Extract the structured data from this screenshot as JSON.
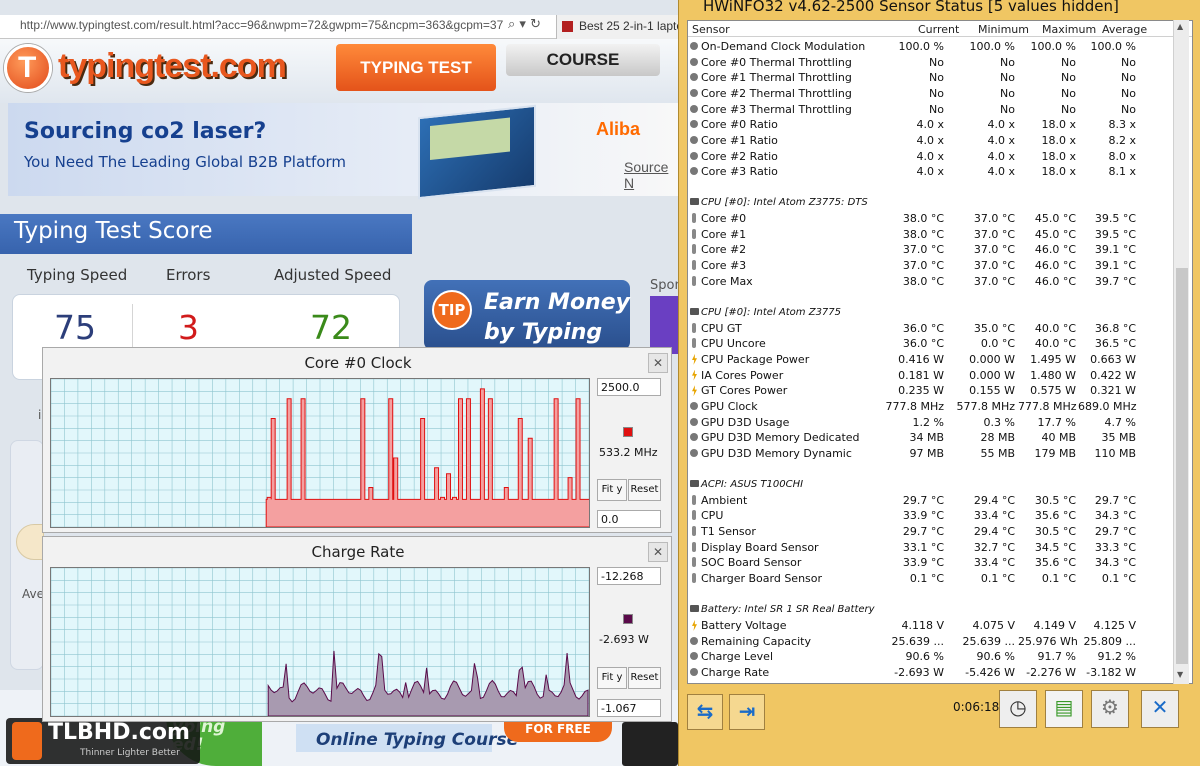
{
  "browser": {
    "url": "http://www.typingtest.com/result.html?acc=96&nwpm=72&gwpm=75&ncpm=363&gcpm=37",
    "tab2_title": "Best 25 2-in-1 lapto"
  },
  "site": {
    "logo": "typingtest.com",
    "nav_typing_test": "TYPING TEST",
    "nav_course": "COURSE",
    "ad_headline": "Sourcing co2 laser?",
    "ad_subline": "You Need The Leading Global B2B Platform",
    "ad_brand": "Aliba",
    "ad_link": "Source N",
    "score_title": "Typing Test Score",
    "labels": {
      "speed": "Typing Speed",
      "errors": "Errors",
      "adjusted": "Adjusted Speed"
    },
    "values": {
      "speed": "75",
      "errors": "3",
      "adjusted": "72"
    },
    "tip_badge": "TIP",
    "tip_text_1": "Earn Money",
    "tip_text_2": "by Typing",
    "sponsor": "Spon",
    "left_fragment": "i",
    "ave_fragment": "Ave",
    "bottom_green": "yping\ned!",
    "bottom_course": "Online Typing Course",
    "bottom_free": "FOR FREE",
    "watermark": "TLBHD.com",
    "watermark_sub": "Thinner Lighter Better"
  },
  "graph_clock": {
    "title": "Core #0 Clock",
    "max_value": "2500.0",
    "current_value": "533.2 MHz",
    "min_value": "0.0",
    "color": "#f08a8a",
    "swatch_color": "#e01010",
    "fit_y": "Fit y",
    "reset": "Reset"
  },
  "graph_charge": {
    "title": "Charge Rate",
    "max_value": "-12.268",
    "current_value": "-2.693 W",
    "min_value": "-1.067",
    "color": "#9a8aa8",
    "swatch_color": "#5a0a4a",
    "fit_y": "Fit y",
    "reset": "Reset"
  },
  "hwinfo": {
    "title": "HWiNFO32 v4.62-2500 Sensor Status [5 values hidden]",
    "columns": [
      "Sensor",
      "Current",
      "Minimum",
      "Maximum",
      "Average"
    ],
    "rows": [
      {
        "type": "row",
        "icon": "circle",
        "name": "On-Demand Clock Modulation",
        "v": [
          "100.0 %",
          "100.0 %",
          "100.0 %",
          "100.0 %"
        ]
      },
      {
        "type": "row",
        "icon": "circle",
        "name": "Core #0 Thermal Throttling",
        "v": [
          "No",
          "No",
          "No",
          "No"
        ]
      },
      {
        "type": "row",
        "icon": "circle",
        "name": "Core #1 Thermal Throttling",
        "v": [
          "No",
          "No",
          "No",
          "No"
        ]
      },
      {
        "type": "row",
        "icon": "circle",
        "name": "Core #2 Thermal Throttling",
        "v": [
          "No",
          "No",
          "No",
          "No"
        ]
      },
      {
        "type": "row",
        "icon": "circle",
        "name": "Core #3 Thermal Throttling",
        "v": [
          "No",
          "No",
          "No",
          "No"
        ]
      },
      {
        "type": "row",
        "icon": "circle",
        "name": "Core #0 Ratio",
        "v": [
          "4.0 x",
          "4.0 x",
          "18.0 x",
          "8.3 x"
        ]
      },
      {
        "type": "row",
        "icon": "circle",
        "name": "Core #1 Ratio",
        "v": [
          "4.0 x",
          "4.0 x",
          "18.0 x",
          "8.2 x"
        ]
      },
      {
        "type": "row",
        "icon": "circle",
        "name": "Core #2 Ratio",
        "v": [
          "4.0 x",
          "4.0 x",
          "18.0 x",
          "8.0 x"
        ]
      },
      {
        "type": "row",
        "icon": "circle",
        "name": "Core #3 Ratio",
        "v": [
          "4.0 x",
          "4.0 x",
          "18.0 x",
          "8.1 x"
        ]
      },
      {
        "type": "blank"
      },
      {
        "type": "group",
        "name": "CPU [#0]: Intel Atom Z3775: DTS"
      },
      {
        "type": "row",
        "icon": "therm",
        "name": "Core #0",
        "v": [
          "38.0 °C",
          "37.0 °C",
          "45.0 °C",
          "39.5 °C"
        ]
      },
      {
        "type": "row",
        "icon": "therm",
        "name": "Core #1",
        "v": [
          "38.0 °C",
          "37.0 °C",
          "45.0 °C",
          "39.5 °C"
        ]
      },
      {
        "type": "row",
        "icon": "therm",
        "name": "Core #2",
        "v": [
          "37.0 °C",
          "37.0 °C",
          "46.0 °C",
          "39.1 °C"
        ]
      },
      {
        "type": "row",
        "icon": "therm",
        "name": "Core #3",
        "v": [
          "37.0 °C",
          "37.0 °C",
          "46.0 °C",
          "39.1 °C"
        ]
      },
      {
        "type": "row",
        "icon": "therm",
        "name": "Core Max",
        "v": [
          "38.0 °C",
          "37.0 °C",
          "46.0 °C",
          "39.7 °C"
        ]
      },
      {
        "type": "blank"
      },
      {
        "type": "group",
        "name": "CPU [#0]: Intel Atom Z3775"
      },
      {
        "type": "row",
        "icon": "therm",
        "name": "CPU GT",
        "v": [
          "36.0 °C",
          "35.0 °C",
          "40.0 °C",
          "36.8 °C"
        ]
      },
      {
        "type": "row",
        "icon": "therm",
        "name": "CPU Uncore",
        "v": [
          "36.0 °C",
          "0.0 °C",
          "40.0 °C",
          "36.5 °C"
        ]
      },
      {
        "type": "row",
        "icon": "power",
        "name": "CPU Package Power",
        "v": [
          "0.416 W",
          "0.000 W",
          "1.495 W",
          "0.663 W"
        ]
      },
      {
        "type": "row",
        "icon": "power",
        "name": "IA Cores Power",
        "v": [
          "0.181 W",
          "0.000 W",
          "1.480 W",
          "0.422 W"
        ]
      },
      {
        "type": "row",
        "icon": "power",
        "name": "GT Cores Power",
        "v": [
          "0.235 W",
          "0.155 W",
          "0.575 W",
          "0.321 W"
        ]
      },
      {
        "type": "row",
        "icon": "circle",
        "name": "GPU Clock",
        "v": [
          "777.8 MHz",
          "577.8 MHz",
          "777.8 MHz",
          "689.0 MHz"
        ]
      },
      {
        "type": "row",
        "icon": "circle",
        "name": "GPU D3D Usage",
        "v": [
          "1.2 %",
          "0.3 %",
          "17.7 %",
          "4.7 %"
        ]
      },
      {
        "type": "row",
        "icon": "circle",
        "name": "GPU D3D Memory Dedicated",
        "v": [
          "34 MB",
          "28 MB",
          "40 MB",
          "35 MB"
        ]
      },
      {
        "type": "row",
        "icon": "circle",
        "name": "GPU D3D Memory Dynamic",
        "v": [
          "97 MB",
          "55 MB",
          "179 MB",
          "110 MB"
        ]
      },
      {
        "type": "blank"
      },
      {
        "type": "group",
        "name": "ACPI: ASUS T100CHI"
      },
      {
        "type": "row",
        "icon": "therm",
        "name": "Ambient",
        "v": [
          "29.7 °C",
          "29.4 °C",
          "30.5 °C",
          "29.7 °C"
        ]
      },
      {
        "type": "row",
        "icon": "therm",
        "name": "CPU",
        "v": [
          "33.9 °C",
          "33.4 °C",
          "35.6 °C",
          "34.3 °C"
        ]
      },
      {
        "type": "row",
        "icon": "therm",
        "name": "T1 Sensor",
        "v": [
          "29.7 °C",
          "29.4 °C",
          "30.5 °C",
          "29.7 °C"
        ]
      },
      {
        "type": "row",
        "icon": "therm",
        "name": "Display Board Sensor",
        "v": [
          "33.1 °C",
          "32.7 °C",
          "34.5 °C",
          "33.3 °C"
        ]
      },
      {
        "type": "row",
        "icon": "therm",
        "name": "SOC Board Sensor",
        "v": [
          "33.9 °C",
          "33.4 °C",
          "35.6 °C",
          "34.3 °C"
        ]
      },
      {
        "type": "row",
        "icon": "therm",
        "name": "Charger Board Sensor",
        "v": [
          "0.1 °C",
          "0.1 °C",
          "0.1 °C",
          "0.1 °C"
        ]
      },
      {
        "type": "blank"
      },
      {
        "type": "group",
        "name": "Battery: Intel SR 1 SR Real Battery"
      },
      {
        "type": "row",
        "icon": "power",
        "name": "Battery Voltage",
        "v": [
          "4.118 V",
          "4.075 V",
          "4.149 V",
          "4.125 V"
        ]
      },
      {
        "type": "row",
        "icon": "circle",
        "name": "Remaining Capacity",
        "v": [
          "25.639 ...",
          "25.639 ...",
          "25.976 Wh",
          "25.809 ..."
        ]
      },
      {
        "type": "row",
        "icon": "circle",
        "name": "Charge Level",
        "v": [
          "90.6 %",
          "90.6 %",
          "91.7 %",
          "91.2 %"
        ]
      },
      {
        "type": "row",
        "icon": "circle",
        "name": "Charge Rate",
        "v": [
          "-2.693 W",
          "-5.426 W",
          "-2.276 W",
          "-3.182 W"
        ]
      }
    ],
    "timer": "0:06:18"
  }
}
